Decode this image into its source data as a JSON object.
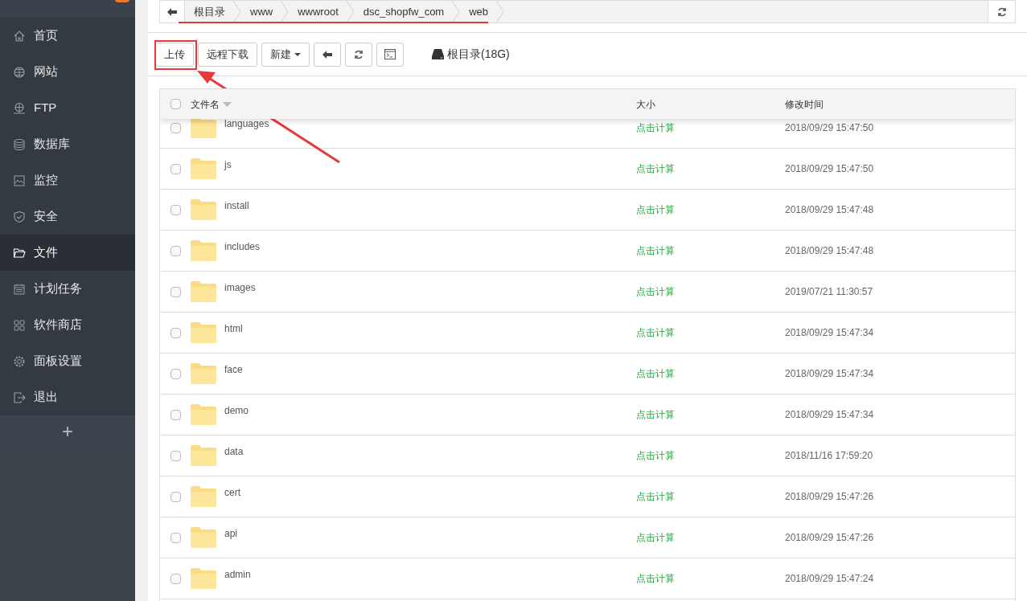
{
  "sidebar": {
    "items": [
      {
        "label": "首页",
        "selected": false
      },
      {
        "label": "网站",
        "selected": false
      },
      {
        "label": "FTP",
        "selected": false
      },
      {
        "label": "数据库",
        "selected": false
      },
      {
        "label": "监控",
        "selected": false
      },
      {
        "label": "安全",
        "selected": false
      },
      {
        "label": "文件",
        "selected": true
      },
      {
        "label": "计划任务",
        "selected": false
      },
      {
        "label": "软件商店",
        "selected": false
      },
      {
        "label": "面板设置",
        "selected": false
      },
      {
        "label": "退出",
        "selected": false
      }
    ],
    "add_button": "+"
  },
  "breadcrumb": [
    "根目录",
    "www",
    "wwwroot",
    "dsc_shopfw_com",
    "web"
  ],
  "toolbar": {
    "buttons": [
      {
        "kind": "text",
        "label": "上传"
      },
      {
        "kind": "text",
        "label": "远程下载"
      },
      {
        "kind": "dropdown",
        "label": "新建"
      },
      {
        "kind": "back"
      },
      {
        "kind": "refresh"
      },
      {
        "kind": "terminal"
      }
    ],
    "disk": "根目录(18G)"
  },
  "table": {
    "all_checked": false,
    "columns": [
      "文件名",
      "大小",
      "修改时间"
    ],
    "rows": [
      {
        "name": "languages",
        "size": "点击计算",
        "modified": "2018/09/29 15:47:50",
        "checked": false
      },
      {
        "name": "js",
        "size": "点击计算",
        "modified": "2018/09/29 15:47:50",
        "checked": false
      },
      {
        "name": "install",
        "size": "点击计算",
        "modified": "2018/09/29 15:47:48",
        "checked": false
      },
      {
        "name": "includes",
        "size": "点击计算",
        "modified": "2018/09/29 15:47:48",
        "checked": false
      },
      {
        "name": "images",
        "size": "点击计算",
        "modified": "2019/07/21 11:30:57",
        "checked": false
      },
      {
        "name": "html",
        "size": "点击计算",
        "modified": "2018/09/29 15:47:34",
        "checked": false
      },
      {
        "name": "face",
        "size": "点击计算",
        "modified": "2018/09/29 15:47:34",
        "checked": false
      },
      {
        "name": "demo",
        "size": "点击计算",
        "modified": "2018/09/29 15:47:34",
        "checked": false
      },
      {
        "name": "data",
        "size": "点击计算",
        "modified": "2018/11/16 17:59:20",
        "checked": false
      },
      {
        "name": "cert",
        "size": "点击计算",
        "modified": "2018/09/29 15:47:26",
        "checked": false
      },
      {
        "name": "api",
        "size": "点击计算",
        "modified": "2018/09/29 15:47:26",
        "checked": false
      },
      {
        "name": "admin",
        "size": "点击计算",
        "modified": "2018/09/29 15:47:24",
        "checked": false
      }
    ]
  }
}
